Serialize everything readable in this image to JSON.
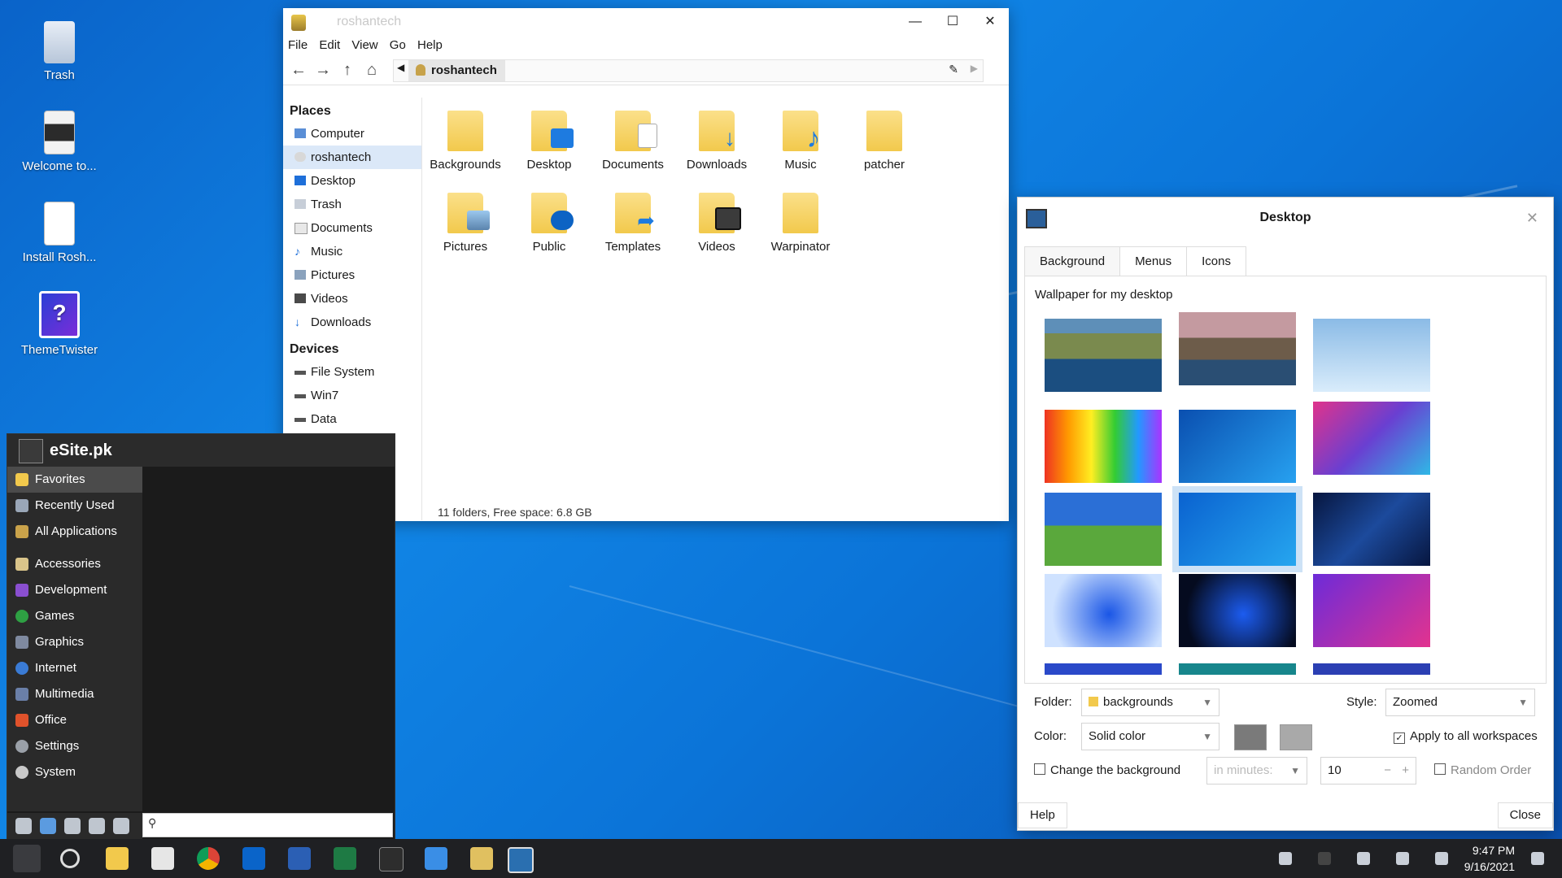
{
  "desktop": {
    "icons": [
      {
        "label": "Trash",
        "icon": "trash-icon"
      },
      {
        "label": "Welcome to...",
        "icon": "document-icon"
      },
      {
        "label": "Install Rosh...",
        "icon": "document-icon"
      },
      {
        "label": "ThemeTwister",
        "icon": "themetwister-icon"
      }
    ]
  },
  "file_manager": {
    "title": "roshantech",
    "menu": [
      "File",
      "Edit",
      "View",
      "Go",
      "Help"
    ],
    "path_crumb": "roshantech",
    "places_header": "Places",
    "places": [
      "Computer",
      "roshantech",
      "Desktop",
      "Trash",
      "Documents",
      "Music",
      "Pictures",
      "Videos",
      "Downloads"
    ],
    "devices_header": "Devices",
    "devices": [
      "File System",
      "Win7",
      "Data"
    ],
    "folders": [
      "Backgrounds",
      "Desktop",
      "Documents",
      "Downloads",
      "Music",
      "patcher",
      "Pictures",
      "Public",
      "Templates",
      "Videos",
      "Warpinator"
    ],
    "status": "11 folders, Free space: 6.8 GB"
  },
  "desktop_dialog": {
    "title": "Desktop",
    "tabs": [
      "Background",
      "Menus",
      "Icons"
    ],
    "wallpaper_label": "Wallpaper for my desktop",
    "folder_label": "Folder:",
    "folder_value": "backgrounds",
    "style_label": "Style:",
    "style_value": "Zoomed",
    "color_label": "Color:",
    "color_value": "Solid color",
    "apply_all_label": "Apply to all workspaces",
    "change_bg_label": "Change the background",
    "interval_placeholder": "in minutes:",
    "interval_value": "10",
    "random_label": "Random Order",
    "help_button": "Help",
    "close_button": "Close",
    "colors": {
      "primary": "#7a7a7a",
      "secondary": "#a9a9a9"
    }
  },
  "start_menu": {
    "user": "eSite.pk",
    "categories": [
      "Favorites",
      "Recently Used",
      "All Applications",
      "Accessories",
      "Development",
      "Games",
      "Graphics",
      "Internet",
      "Multimedia",
      "Office",
      "Settings",
      "System"
    ]
  },
  "taskbar": {
    "time": "9:47 PM",
    "date": "9/16/2021"
  }
}
